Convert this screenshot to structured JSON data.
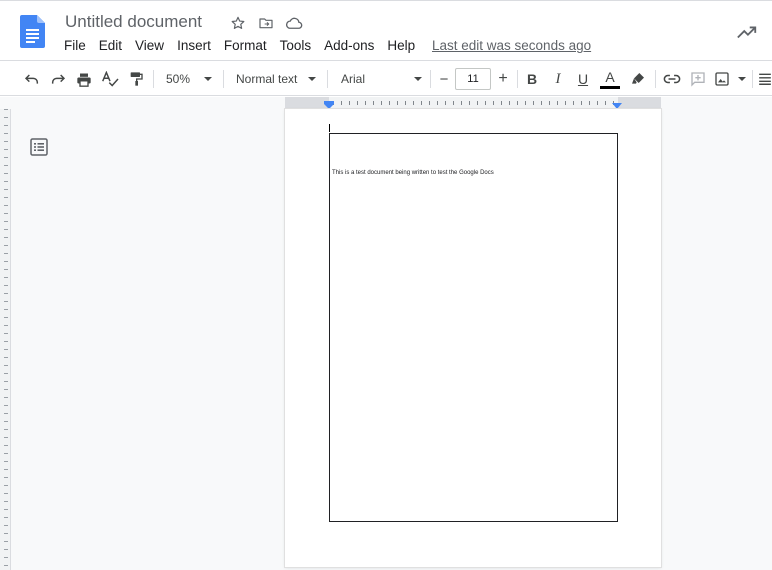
{
  "header": {
    "title": "Untitled document",
    "menu": [
      "File",
      "Edit",
      "View",
      "Insert",
      "Format",
      "Tools",
      "Add-ons",
      "Help"
    ],
    "last_edit": "Last edit was seconds ago",
    "title_icons": [
      "star-icon",
      "move-to-folder-icon",
      "cloud-saved-icon"
    ],
    "right_icon": "activity-trend-icon"
  },
  "toolbar": {
    "zoom": "50%",
    "style": "Normal text",
    "font": "Arial",
    "font_size": "11",
    "minus": "−",
    "plus": "+",
    "bold": "B",
    "italic": "I",
    "underline": "U",
    "text_color_glyph": "A",
    "icons": [
      "undo-icon",
      "redo-icon",
      "print-icon",
      "spellcheck-icon",
      "paint-format-icon",
      "highlighter-icon",
      "link-icon",
      "comment-icon",
      "image-icon",
      "align-icon"
    ]
  },
  "document": {
    "body_text": "This is a test document being written to test the Google Docs"
  },
  "colors": {
    "brand_blue": "#4285f4",
    "text_color_bar": "#000000",
    "canvas": "#f8f9fa"
  }
}
